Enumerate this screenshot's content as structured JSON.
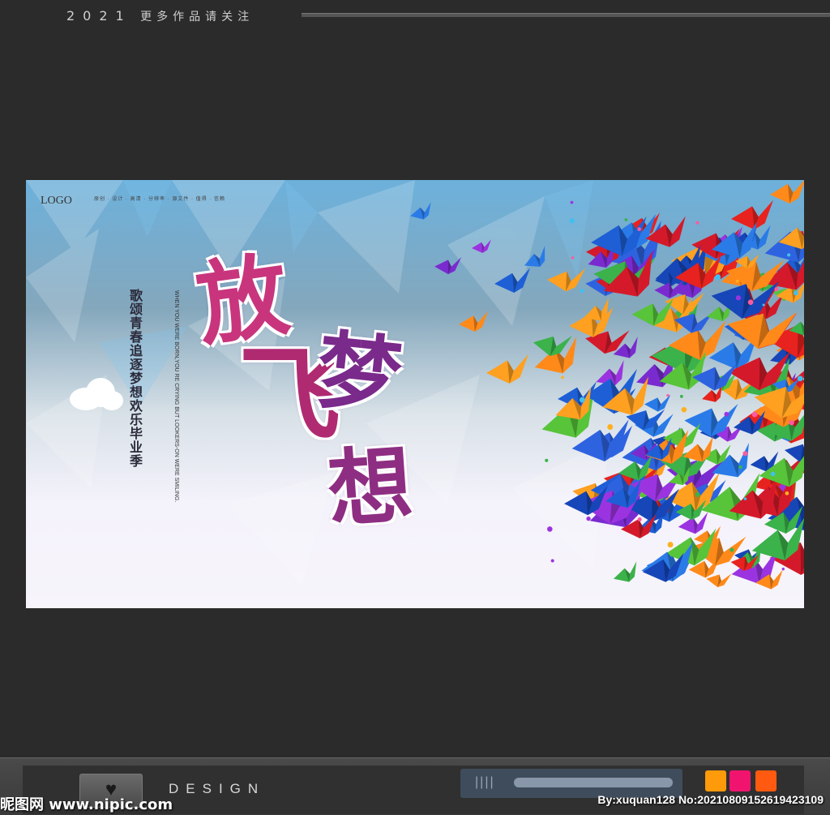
{
  "header": {
    "year": "2021",
    "caption": "更多作品请关注"
  },
  "poster": {
    "logo": "LOGO",
    "tagline": "原创 · 设计 · 高清 · 分辨率 · 源文件 · 值得 · 信赖",
    "title_chars": [
      "放",
      "飞",
      "梦",
      "想"
    ],
    "slogan": "歌颂青春追逐梦想欢乐毕业季",
    "english_text": "WHEN YOU WERE BORN,YOU  RE CRYING BUT LOOKERS-ON WERE SMILING."
  },
  "footer": {
    "design_label": "DESIGN",
    "heart_icon": "heart-icon",
    "swatch_colors": [
      "#ff9b0a",
      "#f0146e",
      "#ff5a10"
    ],
    "slider_ticks": "||||",
    "watermark_left": "昵图网 www.nipic.com",
    "watermark_right": "By:xuquan128 No:20210809152619423109"
  }
}
